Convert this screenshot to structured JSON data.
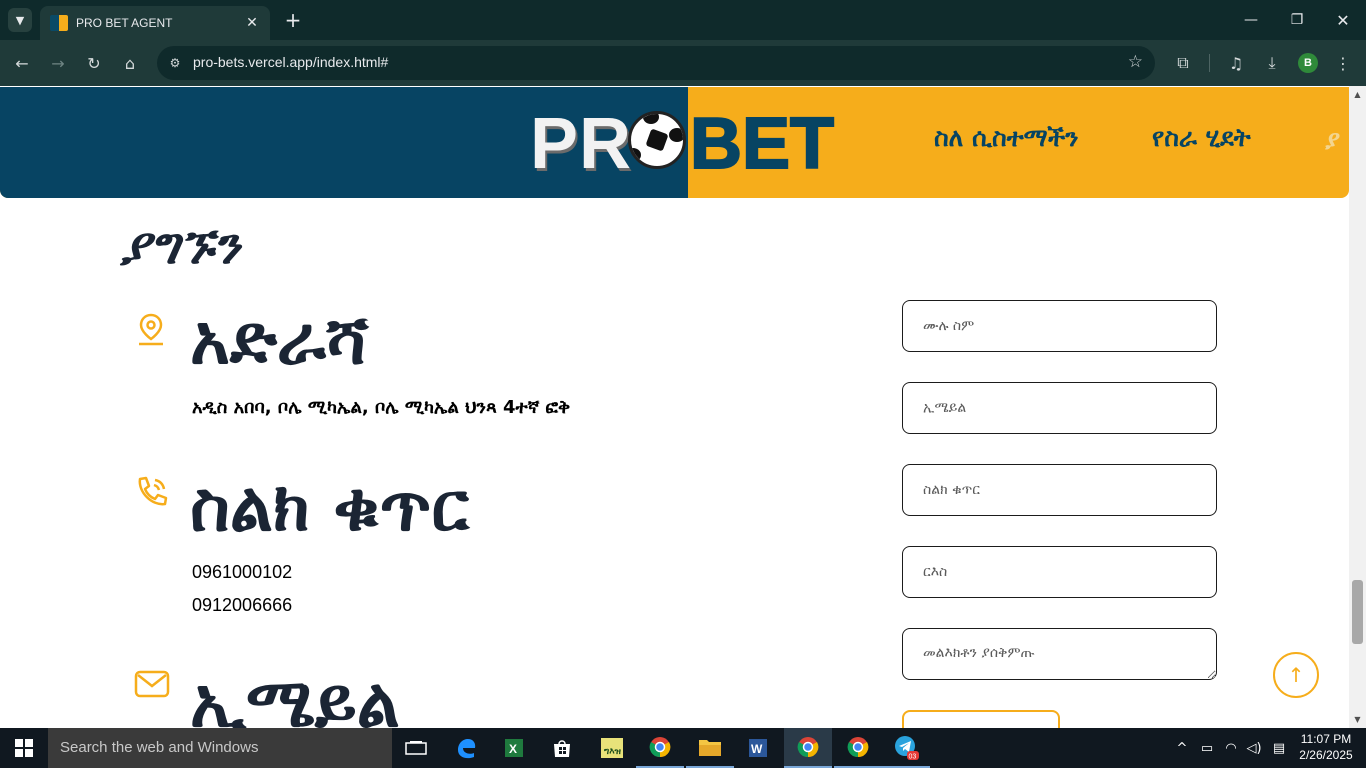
{
  "browser": {
    "tab_title": "PRO BET AGENT",
    "url": "pro-bets.vercel.app/index.html#",
    "profile_initial": "B"
  },
  "navbar": {
    "logo_pro": "PR",
    "logo_bet": "BET",
    "links": [
      "ስለ ሲስተማችን",
      "የስራ ሂደት"
    ],
    "cut_link": "ያ"
  },
  "contact": {
    "heading": "ያግኙን",
    "address": {
      "title": "አድራሻ",
      "text": "አዲስ አበባ, ቦሌ ሚካኤል, ቦሌ ሚካኤል ህንጻ 4ተኛ ፎቅ"
    },
    "phone": {
      "title": "ስልክ ቁጥር",
      "numbers": [
        "0961000102",
        "0912006666"
      ]
    },
    "email": {
      "title": "ኢሜይል"
    }
  },
  "form": {
    "fullname_placeholder": "ሙሉ ስም",
    "email_placeholder": "ኢሜይል",
    "phone_placeholder": "ስልክ ቁጥር",
    "subject_placeholder": "ርእስ",
    "message_placeholder": "መልእክቶን ያሰቅምጡ"
  },
  "taskbar": {
    "search_placeholder": "Search the web and Windows",
    "time": "11:07 PM",
    "date": "2/26/2025",
    "telegram_badge": "03"
  },
  "colors": {
    "brand_blue": "#074463",
    "brand_orange": "#f6ad1b",
    "heading_dark": "#1b2534"
  }
}
